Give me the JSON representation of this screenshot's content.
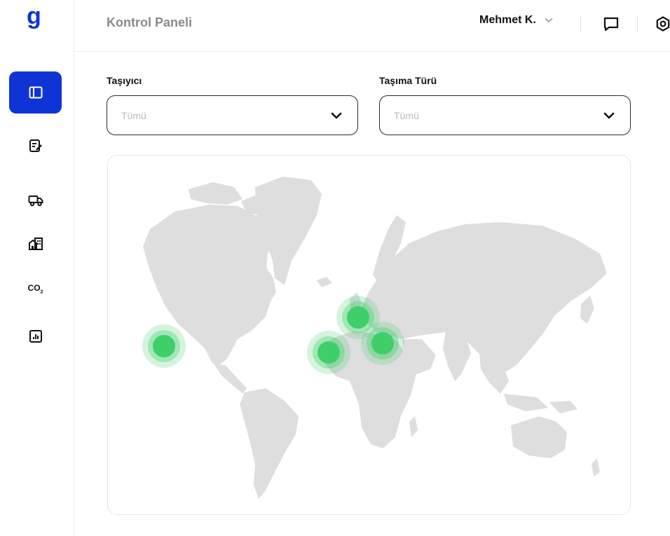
{
  "brand": {
    "logo_glyph": "g",
    "accent_color": "#0f34d6"
  },
  "header": {
    "title": "Kontrol Paneli",
    "user_name": "Mehmet K.",
    "icons": [
      "chevron-down-icon",
      "chat-icon",
      "settings-icon"
    ]
  },
  "sidebar": {
    "items": [
      {
        "name": "dashboard",
        "icon": "sidebar-layout-icon",
        "active": true
      },
      {
        "name": "shipments",
        "icon": "edit-document-icon",
        "active": false
      },
      {
        "name": "carriers",
        "icon": "truck-icon",
        "active": false
      },
      {
        "name": "warehouses",
        "icon": "buildings-icon",
        "active": false
      },
      {
        "name": "emissions",
        "icon": "co2-icon",
        "label": "CO2",
        "active": false
      },
      {
        "name": "reports",
        "icon": "bar-chart-icon",
        "active": false
      }
    ]
  },
  "filters": {
    "carrier": {
      "label": "Taşıyıcı",
      "value": "Tümü"
    },
    "transport_type": {
      "label": "Taşıma Türü",
      "value": "Tümü"
    }
  },
  "map": {
    "land_color": "#dedede",
    "marker_color": "#3ecf6a",
    "markers": [
      {
        "name": "marker-north-america-west"
      },
      {
        "name": "marker-west-europe"
      },
      {
        "name": "marker-west-africa"
      },
      {
        "name": "marker-east-mediterranean"
      }
    ]
  }
}
